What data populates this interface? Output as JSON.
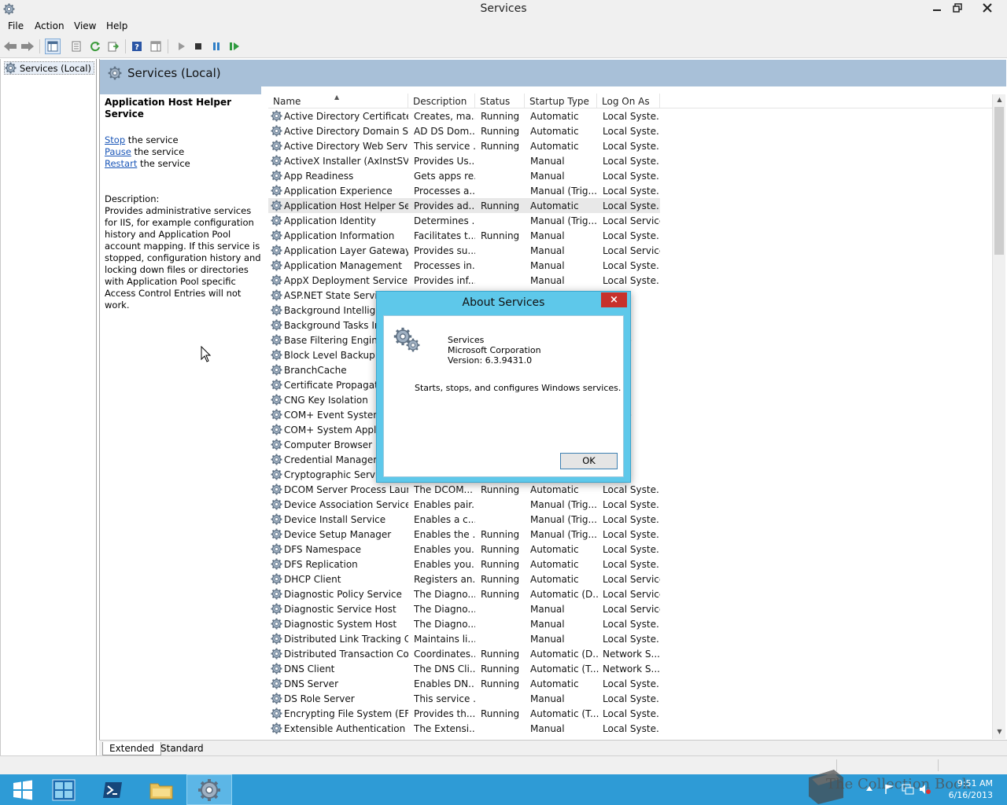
{
  "window": {
    "title": "Services"
  },
  "menu": [
    "File",
    "Action",
    "View",
    "Help"
  ],
  "tree": {
    "root_label": "Services (Local)"
  },
  "main": {
    "header_title": "Services (Local)",
    "detail": {
      "service_name": "Application Host Helper Service",
      "actions": [
        {
          "link": "Stop",
          "suffix": " the service"
        },
        {
          "link": "Pause",
          "suffix": " the service"
        },
        {
          "link": "Restart",
          "suffix": " the service"
        }
      ],
      "description_label": "Description:",
      "description_text": "Provides administrative services for IIS, for example configuration history and Application Pool account mapping. If this service is stopped, configuration history and locking down files or directories with Application Pool specific Access Control Entries will not work."
    },
    "columns": [
      "Name",
      "Description",
      "Status",
      "Startup Type",
      "Log On As"
    ],
    "rows": [
      [
        "Active Directory Certificate ...",
        "Creates, ma...",
        "Running",
        "Automatic",
        "Local Syste..."
      ],
      [
        "Active Directory Domain Se...",
        "AD DS Dom...",
        "Running",
        "Automatic",
        "Local Syste..."
      ],
      [
        "Active Directory Web Services",
        "This service ...",
        "Running",
        "Automatic",
        "Local Syste..."
      ],
      [
        "ActiveX Installer (AxInstSV)",
        "Provides Us...",
        "",
        "Manual",
        "Local Syste..."
      ],
      [
        "App Readiness",
        "Gets apps re...",
        "",
        "Manual",
        "Local Syste..."
      ],
      [
        "Application Experience",
        "Processes a...",
        "",
        "Manual (Trig...",
        "Local Syste..."
      ],
      [
        "Application Host Helper Ser...",
        "Provides ad...",
        "Running",
        "Automatic",
        "Local Syste..."
      ],
      [
        "Application Identity",
        "Determines ...",
        "",
        "Manual (Trig...",
        "Local Service"
      ],
      [
        "Application Information",
        "Facilitates t...",
        "Running",
        "Manual",
        "Local Syste..."
      ],
      [
        "Application Layer Gateway ...",
        "Provides su...",
        "",
        "Manual",
        "Local Service"
      ],
      [
        "Application Management",
        "Processes in...",
        "",
        "Manual",
        "Local Syste..."
      ],
      [
        "AppX Deployment Service (...",
        "Provides inf...",
        "",
        "Manual",
        "Local Syste..."
      ],
      [
        "ASP.NET State Service",
        "",
        "",
        "",
        "rk S..."
      ],
      [
        "Background Intelligent",
        "",
        "",
        "",
        "yste..."
      ],
      [
        "Background Tasks Infr",
        "",
        "",
        "",
        "yste..."
      ],
      [
        "Base Filtering Engine",
        "",
        "",
        "",
        "ervice"
      ],
      [
        "Block Level Backup En",
        "",
        "",
        "",
        "yste..."
      ],
      [
        "BranchCache",
        "",
        "",
        "",
        "rk S..."
      ],
      [
        "Certificate Propagation",
        "",
        "",
        "",
        "yste..."
      ],
      [
        "CNG Key Isolation",
        "",
        "",
        "",
        "yste..."
      ],
      [
        "COM+ Event System",
        "",
        "",
        "",
        "ervice"
      ],
      [
        "COM+ System Applica",
        "",
        "",
        "",
        "yste..."
      ],
      [
        "Computer Browser",
        "",
        "",
        "",
        "yste..."
      ],
      [
        "Credential Manager",
        "",
        "",
        "",
        "yste..."
      ],
      [
        "Cryptographic Service",
        "",
        "",
        "",
        "rk S..."
      ],
      [
        "DCOM Server Process Laun...",
        "The DCOM...",
        "Running",
        "Automatic",
        "Local Syste..."
      ],
      [
        "Device Association Service",
        "Enables pair...",
        "",
        "Manual (Trig...",
        "Local Syste..."
      ],
      [
        "Device Install Service",
        "Enables a c...",
        "",
        "Manual (Trig...",
        "Local Syste..."
      ],
      [
        "Device Setup Manager",
        "Enables the ...",
        "Running",
        "Manual (Trig...",
        "Local Syste..."
      ],
      [
        "DFS Namespace",
        "Enables you...",
        "Running",
        "Automatic",
        "Local Syste..."
      ],
      [
        "DFS Replication",
        "Enables you...",
        "Running",
        "Automatic",
        "Local Syste..."
      ],
      [
        "DHCP Client",
        "Registers an...",
        "Running",
        "Automatic",
        "Local Service"
      ],
      [
        "Diagnostic Policy Service",
        "The Diagno...",
        "Running",
        "Automatic (D...",
        "Local Service"
      ],
      [
        "Diagnostic Service Host",
        "The Diagno...",
        "",
        "Manual",
        "Local Service"
      ],
      [
        "Diagnostic System Host",
        "The Diagno...",
        "",
        "Manual",
        "Local Syste..."
      ],
      [
        "Distributed Link Tracking Cl...",
        "Maintains li...",
        "",
        "Manual",
        "Local Syste..."
      ],
      [
        "Distributed Transaction Co...",
        "Coordinates...",
        "Running",
        "Automatic (D...",
        "Network S..."
      ],
      [
        "DNS Client",
        "The DNS Cli...",
        "Running",
        "Automatic (T...",
        "Network S..."
      ],
      [
        "DNS Server",
        "Enables DN...",
        "Running",
        "Automatic",
        "Local Syste..."
      ],
      [
        "DS Role Server",
        "This service ...",
        "",
        "Manual",
        "Local Syste..."
      ],
      [
        "Encrypting File System (EFS)",
        "Provides th...",
        "Running",
        "Automatic (T...",
        "Local Syste..."
      ],
      [
        "Extensible Authentication P...",
        "The Extensi...",
        "",
        "Manual",
        "Local Syste..."
      ]
    ],
    "selected_row": 6
  },
  "tabs": [
    "Extended",
    "Standard"
  ],
  "dialog": {
    "title": "About Services",
    "close_glyph": "×",
    "product": "Services",
    "company": "Microsoft Corporation",
    "version": "Version: 6.3.9431.0",
    "description": "Starts, stops, and configures Windows services.",
    "ok_label": "OK"
  },
  "taskbar": {
    "clock_time": "9:51 AM",
    "clock_date": "6/16/2013",
    "watermark": "The Collection Book"
  },
  "colors": {
    "taskbar": "#2e9bd6",
    "dialog_frame": "#5ec8ea",
    "header_band": "#a8c0d8",
    "link": "#1a56b8",
    "close_button": "#c7312b"
  }
}
